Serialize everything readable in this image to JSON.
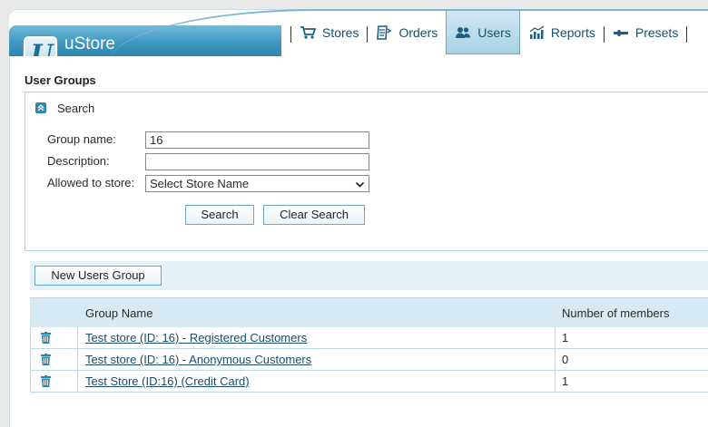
{
  "app": {
    "name": "uStore",
    "logo_letter": "U"
  },
  "nav": {
    "items": [
      {
        "label": "Stores",
        "icon": "cart-icon",
        "active": false
      },
      {
        "label": "Orders",
        "icon": "orders-icon",
        "active": false
      },
      {
        "label": "Users",
        "icon": "users-icon",
        "active": true
      },
      {
        "label": "Reports",
        "icon": "chart-icon",
        "active": false
      },
      {
        "label": "Presets",
        "icon": "wrench-icon",
        "active": false
      }
    ]
  },
  "page": {
    "title": "User Groups"
  },
  "search": {
    "header": "Search",
    "group_name_label": "Group name:",
    "group_name_value": "16",
    "description_label": "Description:",
    "description_value": "",
    "store_label": "Allowed to store:",
    "store_selected": "Select Store Name",
    "search_button": "Search",
    "clear_button": "Clear Search"
  },
  "actions": {
    "new_group_button": "New Users Group"
  },
  "grid": {
    "columns": [
      "Group Name",
      "Number of members"
    ],
    "rows": [
      {
        "name": "Test store (ID: 16) - Registered Customers",
        "members": "1"
      },
      {
        "name": "Test store (ID: 16) - Anonymous Customers",
        "members": "0"
      },
      {
        "name": "Test Store (ID:16) (Credit Card)",
        "members": "1"
      }
    ]
  },
  "colors": {
    "accent": "#2f86ae",
    "header_row": "#d7eaf3",
    "link": "#1b4d6b"
  }
}
